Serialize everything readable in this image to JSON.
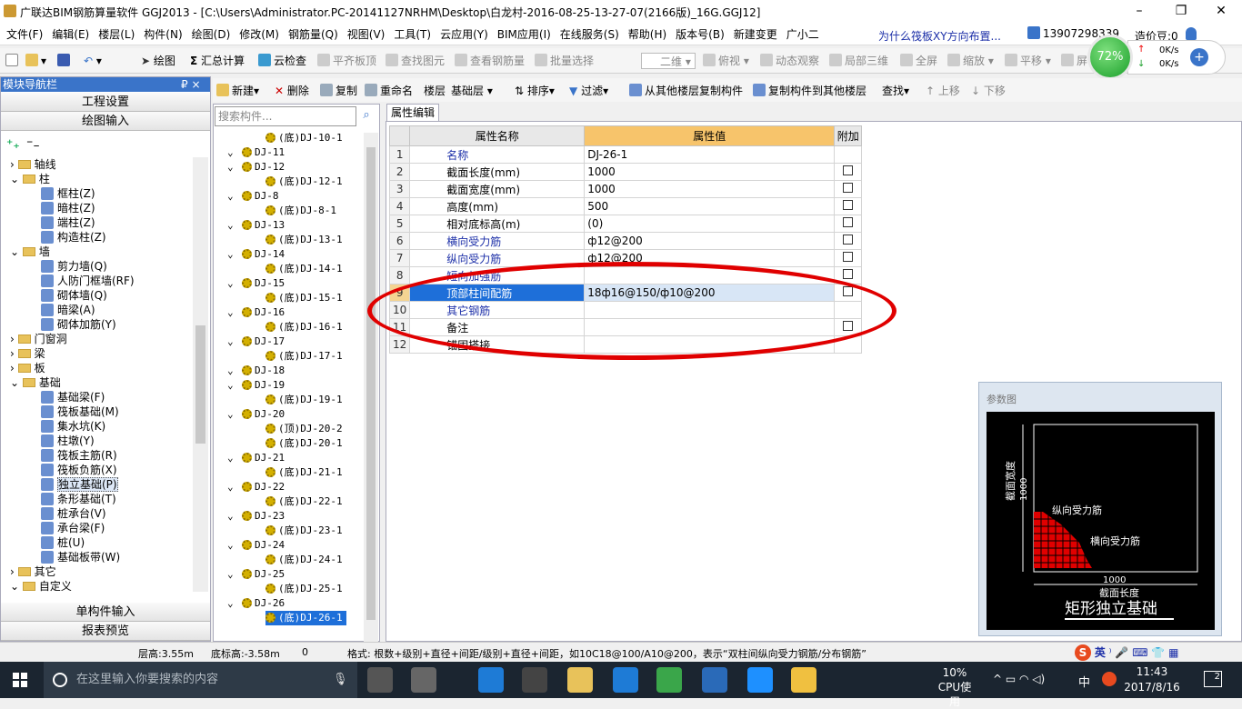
{
  "title": "广联达BIM钢筋算量软件 GGJ2013 - [C:\\Users\\Administrator.PC-20141127NRHM\\Desktop\\白龙村-2016-08-25-13-27-07(2166版)_16G.GGJ12]",
  "window": {
    "min": "–",
    "max": "❐",
    "close": "✕"
  },
  "menu": [
    "文件(F)",
    "编辑(E)",
    "楼层(L)",
    "构件(N)",
    "绘图(D)",
    "修改(M)",
    "钢筋量(Q)",
    "视图(V)",
    "工具(T)",
    "云应用(Y)",
    "BIM应用(I)",
    "在线服务(S)",
    "帮助(H)",
    "版本号(B)",
    "新建变更",
    "广小二"
  ],
  "menu_link": "为什么筏板XY方向布置...",
  "account": {
    "phone": "13907298339",
    "beans": "造价豆:0"
  },
  "toolbar1": {
    "draw": "绘图",
    "sum": "汇总计算",
    "cloud": "云检查",
    "align": "平齐板顶",
    "find": "查找图元",
    "view_rebar": "查看钢筋量",
    "batch": "批量选择",
    "dim": "二维",
    "top": "俯视",
    "orbit": "动态观察",
    "local3d": "局部三维",
    "full": "全屏",
    "zoom": "缩放",
    "pan": "平移",
    "screen": "屏"
  },
  "net": {
    "percent": "72%",
    "up": "0K/s",
    "down": "0K/s"
  },
  "left": {
    "title": "模块导航栏",
    "pin": "₽ ×",
    "btn1": "工程设置",
    "btn2": "绘图输入",
    "btn3": "单构件输入",
    "btn4": "报表预览",
    "tree": [
      "轴线",
      "柱",
      "框柱(Z)",
      "暗柱(Z)",
      "端柱(Z)",
      "构造柱(Z)",
      "墙",
      "剪力墙(Q)",
      "人防门框墙(RF)",
      "砌体墙(Q)",
      "暗梁(A)",
      "砌体加筋(Y)",
      "门窗洞",
      "梁",
      "板",
      "基础",
      "基础梁(F)",
      "筏板基础(M)",
      "集水坑(K)",
      "柱墩(Y)",
      "筏板主筋(R)",
      "筏板负筋(X)",
      "独立基础(P)",
      "条形基础(T)",
      "桩承台(V)",
      "承台梁(F)",
      "桩(U)",
      "基础板带(W)",
      "其它",
      "自定义"
    ]
  },
  "toolbar2": {
    "new": "新建",
    "del": "删除",
    "copy": "复制",
    "rename": "重命名",
    "floor": "楼层",
    "floor_val": "基础层",
    "sort": "排序",
    "filter": "过滤",
    "copy_from": "从其他楼层复制构件",
    "copy_to": "复制构件到其他楼层",
    "find": "查找",
    "up": "上移",
    "down": "下移"
  },
  "search_placeholder": "搜索构件...",
  "components": [
    "(底)DJ-10-1",
    "DJ-11",
    "DJ-12",
    "(底)DJ-12-1",
    "DJ-8",
    "(底)DJ-8-1",
    "DJ-13",
    "(底)DJ-13-1",
    "DJ-14",
    "(底)DJ-14-1",
    "DJ-15",
    "(底)DJ-15-1",
    "DJ-16",
    "(底)DJ-16-1",
    "DJ-17",
    "(底)DJ-17-1",
    "DJ-18",
    "DJ-19",
    "(底)DJ-19-1",
    "DJ-20",
    "(顶)DJ-20-2",
    "(底)DJ-20-1",
    "DJ-21",
    "(底)DJ-21-1",
    "DJ-22",
    "(底)DJ-22-1",
    "DJ-23",
    "(底)DJ-23-1",
    "DJ-24",
    "(底)DJ-24-1",
    "DJ-25",
    "(底)DJ-25-1",
    "DJ-26",
    "(底)DJ-26-1"
  ],
  "prop": {
    "tab": "属性编辑",
    "h_name": "属性名称",
    "h_value": "属性值",
    "h_extra": "附加",
    "rows": [
      {
        "n": "1",
        "name": "名称",
        "value": "DJ-26-1",
        "blue": true,
        "cb": false
      },
      {
        "n": "2",
        "name": "截面长度(mm)",
        "value": "1000",
        "cb": true
      },
      {
        "n": "3",
        "name": "截面宽度(mm)",
        "value": "1000",
        "cb": true
      },
      {
        "n": "4",
        "name": "高度(mm)",
        "value": "500",
        "cb": true
      },
      {
        "n": "5",
        "name": "相对底标高(m)",
        "value": "(0)",
        "cb": true
      },
      {
        "n": "6",
        "name": "横向受力筋",
        "value": "ф12@200",
        "blue": true,
        "cb": true
      },
      {
        "n": "7",
        "name": "纵向受力筋",
        "value": "ф12@200",
        "blue": true,
        "cb": true
      },
      {
        "n": "8",
        "name": "短向加强筋",
        "value": "",
        "blue": true,
        "cb": true
      },
      {
        "n": "9",
        "name": "顶部柱间配筋",
        "value": "18ф16@150/ф10@200",
        "sel": true,
        "cb": true
      },
      {
        "n": "10",
        "name": "其它钢筋",
        "value": "",
        "blue": true,
        "cb": false
      },
      {
        "n": "11",
        "name": "备注",
        "value": "",
        "cb": true
      },
      {
        "n": "12",
        "name": "锚固搭接",
        "value": "",
        "cb": false
      }
    ]
  },
  "param": {
    "title": "参数图",
    "width_label": "截面宽度",
    "width_val": "1000",
    "long_bar": "纵向受力筋",
    "trans_bar": "横向受力筋",
    "len_val": "1000",
    "len_label": "截面长度",
    "caption": "矩形独立基础"
  },
  "status": {
    "floor_h": "层高:3.55m",
    "base_h": "底标高:-3.58m",
    "zero": "0",
    "hint": "格式: 根数+级别+直径+间距/级别+直径+间距，如10C18@100/A10@200，表示“双柱间纵向受力钢筋/分布钢筋”"
  },
  "taskbar": {
    "search": "在这里输入你要搜索的内容",
    "cpu_val": "10%",
    "cpu_label": "CPU使用",
    "time": "11:43",
    "date": "2017/8/16",
    "ime": "中",
    "notify": "2"
  }
}
